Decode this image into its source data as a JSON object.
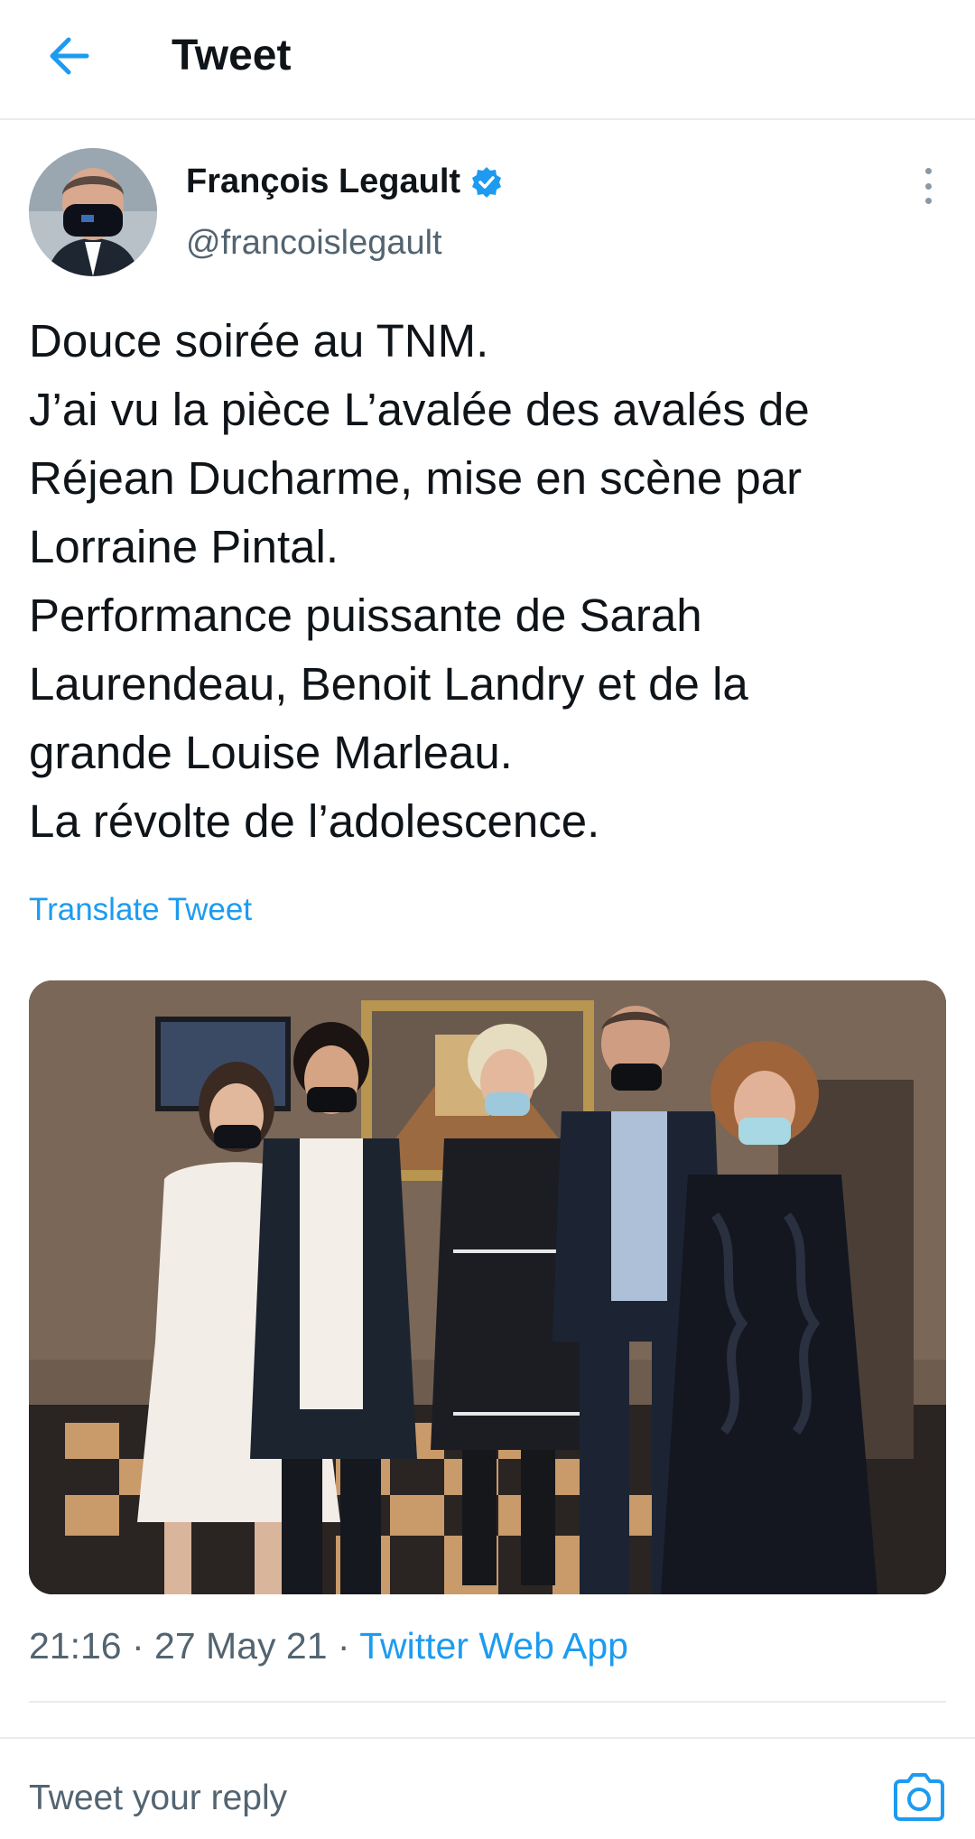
{
  "header": {
    "title": "Tweet",
    "back_icon": "arrow-left-icon"
  },
  "author": {
    "name": "François Legault",
    "handle": "@francoislegault",
    "verified": true,
    "avatar_icon": "avatar-photo"
  },
  "tweet": {
    "lines": [
      "Douce soirée au TNM.",
      "J’ai vu la pièce L’avalée des avalés de",
      "Réjean Ducharme, mise en scène par",
      "Lorraine Pintal.",
      "Performance puissante de Sarah",
      "Laurendeau, Benoit Landry et de la",
      "grande Louise Marleau.",
      "La révolte de l’adolescence."
    ],
    "translate_label": "Translate Tweet"
  },
  "meta": {
    "time": "21:16",
    "separator": " · ",
    "date": "27 May 21",
    "source": "Twitter Web App"
  },
  "reply": {
    "placeholder": "Tweet your reply",
    "camera_icon": "camera-icon"
  },
  "colors": {
    "accent": "#1d9bf0",
    "text": "#0f1419",
    "secondary": "#536471",
    "divider": "#e6ecf0"
  }
}
